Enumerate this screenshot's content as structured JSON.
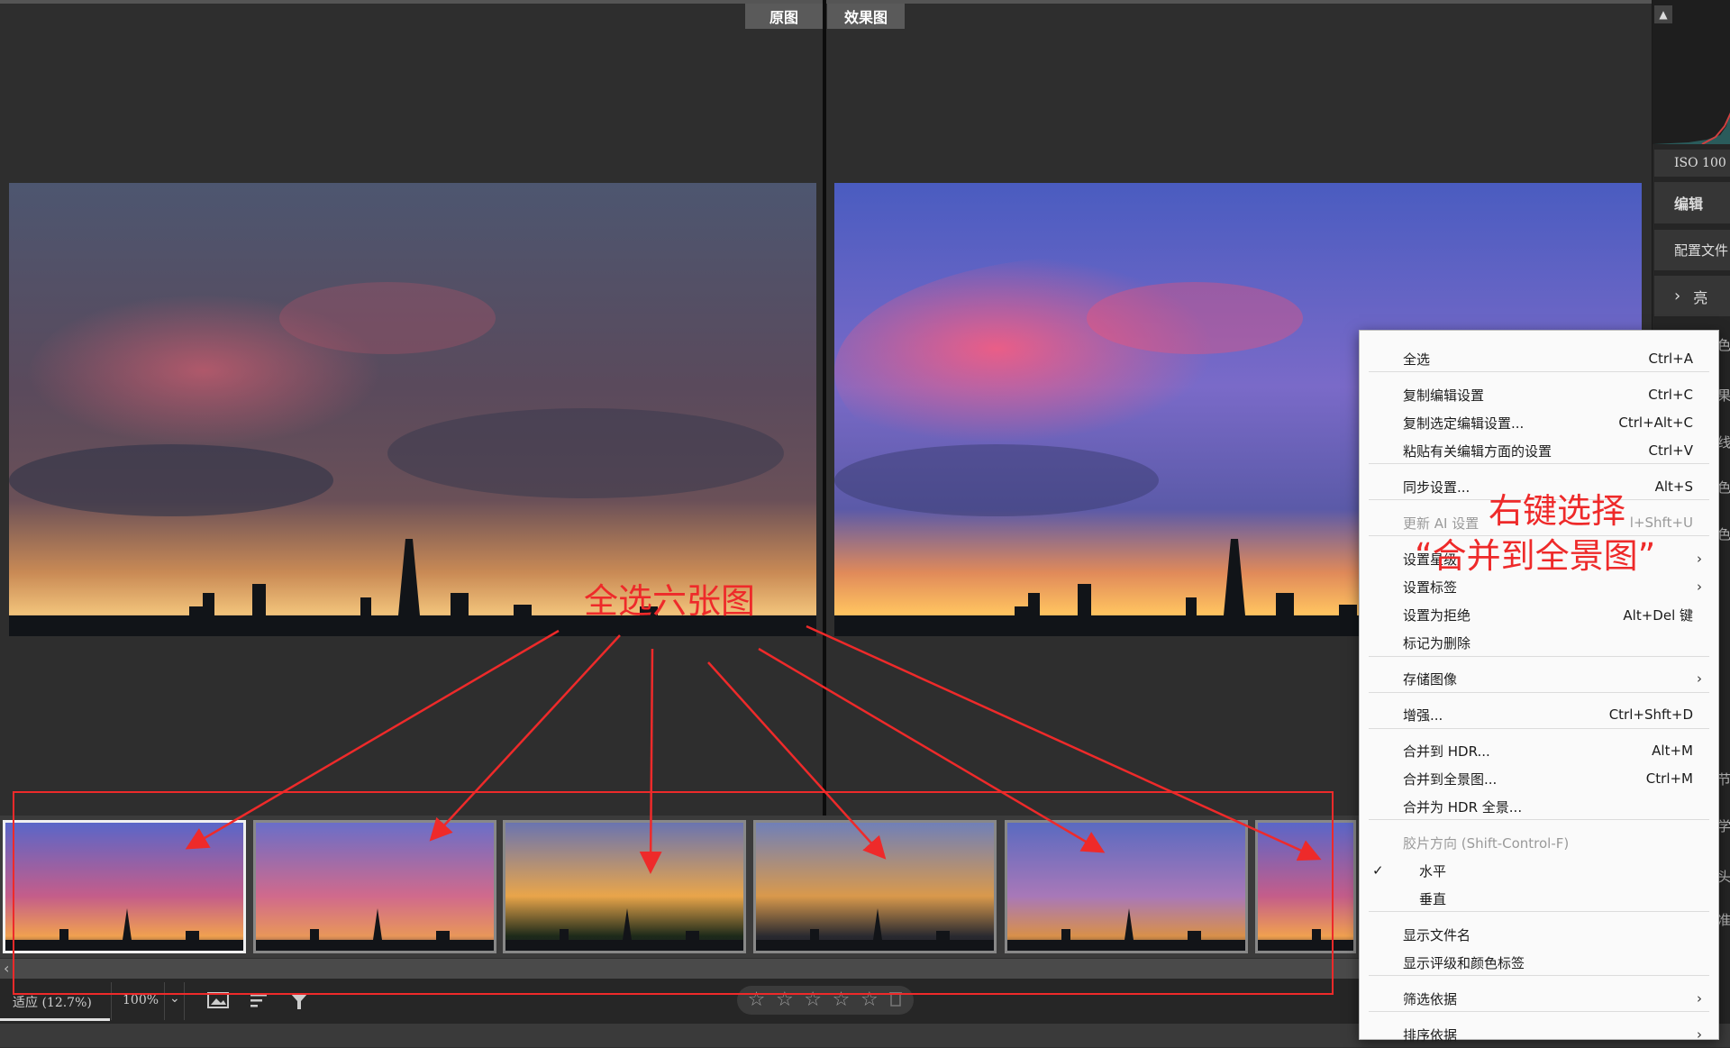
{
  "views": {
    "before_label": "原图",
    "after_label": "效果图"
  },
  "right_panel": {
    "iso": "ISO 100",
    "edit": "编辑",
    "profile": "配置文件",
    "light": "亮",
    "side_glyphs": [
      "色",
      "果",
      "线",
      "色",
      "色",
      "节",
      "学",
      "头",
      "准"
    ]
  },
  "context_menu": {
    "items": [
      {
        "label": "全选",
        "shortcut": "Ctrl+A"
      },
      {
        "label": "复制编辑设置",
        "shortcut": "Ctrl+C"
      },
      {
        "label": "复制选定编辑设置...",
        "shortcut": "Ctrl+Alt+C"
      },
      {
        "label": "粘贴有关编辑方面的设置",
        "shortcut": "Ctrl+V"
      },
      {
        "label": "同步设置...",
        "shortcut": "Alt+S"
      },
      {
        "label": "更新 AI 设置",
        "shortcut": "l+Shft+U"
      },
      {
        "label": "设置星级",
        "shortcut": "›"
      },
      {
        "label": "设置标签",
        "shortcut": "›"
      },
      {
        "label": "设置为拒绝",
        "shortcut": "Alt+Del 键"
      },
      {
        "label": "标记为删除",
        "shortcut": ""
      },
      {
        "label": "存储图像",
        "shortcut": "›"
      },
      {
        "label": "增强...",
        "shortcut": "Ctrl+Shft+D"
      },
      {
        "label": "合并到 HDR...",
        "shortcut": "Alt+M"
      },
      {
        "label": "合并到全景图...",
        "shortcut": "Ctrl+M"
      },
      {
        "label": "合并为 HDR 全景...",
        "shortcut": ""
      },
      {
        "label": "胶片方向 (Shift-Control-F)",
        "shortcut": ""
      },
      {
        "label": "水平",
        "shortcut": "",
        "checked": true
      },
      {
        "label": "垂直",
        "shortcut": ""
      },
      {
        "label": "显示文件名",
        "shortcut": ""
      },
      {
        "label": "显示评级和颜色标签",
        "shortcut": ""
      },
      {
        "label": "筛选依据",
        "shortcut": "›"
      },
      {
        "label": "排序依据",
        "shortcut": "›"
      }
    ]
  },
  "annotations": {
    "select_all": "全选六张图",
    "right_click": "右键选择",
    "merge_panorama": "“合并到全景图”"
  },
  "toolbar": {
    "fit_zoom": "适应 (12.7%)",
    "zoom_100": "100%",
    "dropdown": "⌄"
  },
  "filmstrip": {
    "count": 6,
    "selected_index": 0,
    "left_arrow": "‹"
  },
  "stars": [
    "☆",
    "☆",
    "☆",
    "☆",
    "☆"
  ],
  "colors": {
    "accent_red": "#ee2a2a",
    "menu_bg": "#fafafa",
    "bg": "#2e2e2e"
  }
}
